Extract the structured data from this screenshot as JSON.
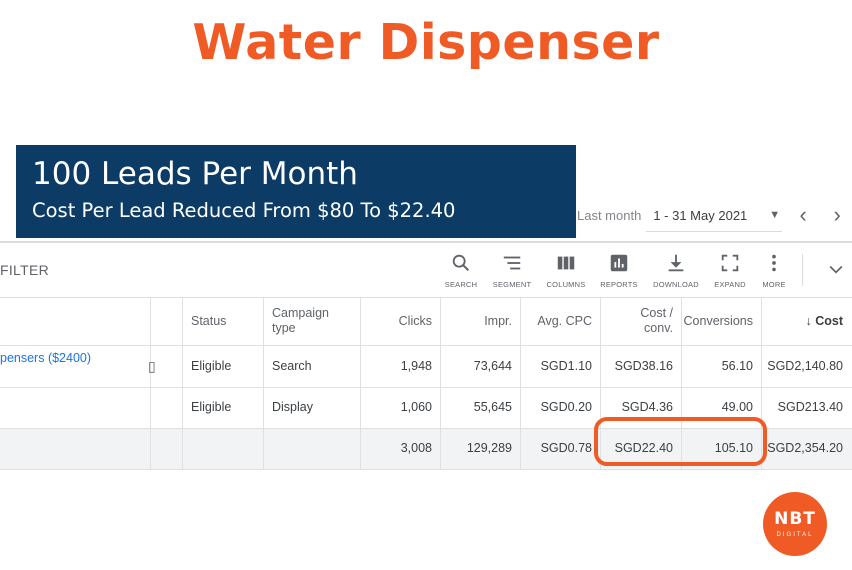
{
  "page": {
    "title": "Water Dispenser"
  },
  "banner": {
    "headline": "100 Leads Per Month",
    "subline": "Cost Per Lead Reduced From $80 To $22.40"
  },
  "date_range": {
    "label": "Last month",
    "value": "1 - 31 May 2021",
    "dropdown_icon": "triangle-down-icon",
    "prev_icon": "chevron-left-icon",
    "next_icon": "chevron-right-icon"
  },
  "toolbar": {
    "filter_label": "FILTER",
    "tools": [
      {
        "label": "SEARCH",
        "icon": "search-icon"
      },
      {
        "label": "SEGMENT",
        "icon": "segment-icon"
      },
      {
        "label": "COLUMNS",
        "icon": "columns-icon"
      },
      {
        "label": "REPORTS",
        "icon": "reports-icon"
      },
      {
        "label": "DOWNLOAD",
        "icon": "download-icon"
      },
      {
        "label": "EXPAND",
        "icon": "expand-icon"
      },
      {
        "label": "MORE",
        "icon": "more-vert-icon"
      }
    ],
    "collapse_icon": "chevron-down-icon"
  },
  "table": {
    "headers": {
      "status": "Status",
      "campaign_type_1": "Campaign",
      "campaign_type_2": "type",
      "clicks": "Clicks",
      "impr": "Impr.",
      "avg_cpc": "Avg. CPC",
      "cost_conv_1": "Cost /",
      "cost_conv_2": "conv.",
      "conversions": "Conversions",
      "cost_arrow": "↓",
      "cost": "Cost"
    },
    "rows": [
      {
        "campaign": "pensers ($2400)",
        "status": "Eligible",
        "type": "Search",
        "clicks": "1,948",
        "impr": "73,644",
        "avg_cpc": "SGD1.10",
        "cost_conv": "SGD38.16",
        "conversions": "56.10",
        "cost": "SGD2,140.80"
      },
      {
        "campaign": "",
        "status": "Eligible",
        "type": "Display",
        "clicks": "1,060",
        "impr": "55,645",
        "avg_cpc": "SGD0.20",
        "cost_conv": "SGD4.36",
        "conversions": "49.00",
        "cost": "SGD213.40"
      }
    ],
    "total": {
      "clicks": "3,008",
      "impr": "129,289",
      "avg_cpc": "SGD0.78",
      "cost_conv": "SGD22.40",
      "conversions": "105.10",
      "cost": "SGD2,354.20"
    }
  },
  "colors": {
    "accent": "#f05a24",
    "banner": "#0c3c66",
    "link": "#1a73e8",
    "total_row": "#f1f3f4"
  },
  "logo": {
    "text": "NBT",
    "subtext": "DIGITAL"
  }
}
